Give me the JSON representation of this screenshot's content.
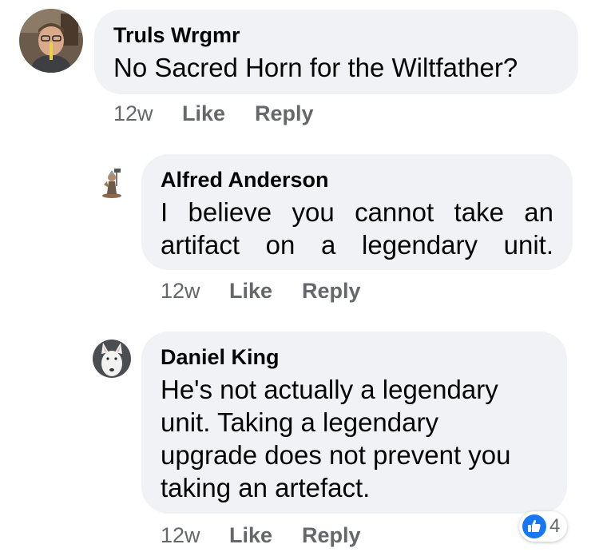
{
  "comments": [
    {
      "author": "Truls Wrgmr",
      "avatar_icon": "avatar-photo-man-with-glasses",
      "text_lines": [
        "No Sacred Horn for the Wiltfather?"
      ],
      "time": "12w",
      "like_label": "Like",
      "reply_label": "Reply"
    },
    {
      "author": "Alfred Anderson",
      "avatar_icon": "avatar-photo-miniature-figure",
      "text_lines": [
        "I believe you cannot take an",
        "artifact on a legendary unit."
      ],
      "time": "12w",
      "like_label": "Like",
      "reply_label": "Reply"
    },
    {
      "author": "Daniel King",
      "avatar_icon": "avatar-photo-white-dog",
      "text_lines": [
        "He's not actually a legendary",
        "unit. Taking a legendary",
        "upgrade does not prevent you",
        "taking an artefact."
      ],
      "time": "12w",
      "like_label": "Like",
      "reply_label": "Reply",
      "reaction": {
        "icon": "thumbs-up-icon",
        "count": "4",
        "color": "#1877f2"
      }
    }
  ],
  "colors": {
    "bubble": "#f0f2f5",
    "text": "#050505",
    "secondary": "#65676b",
    "like_blue": "#1877f2"
  }
}
